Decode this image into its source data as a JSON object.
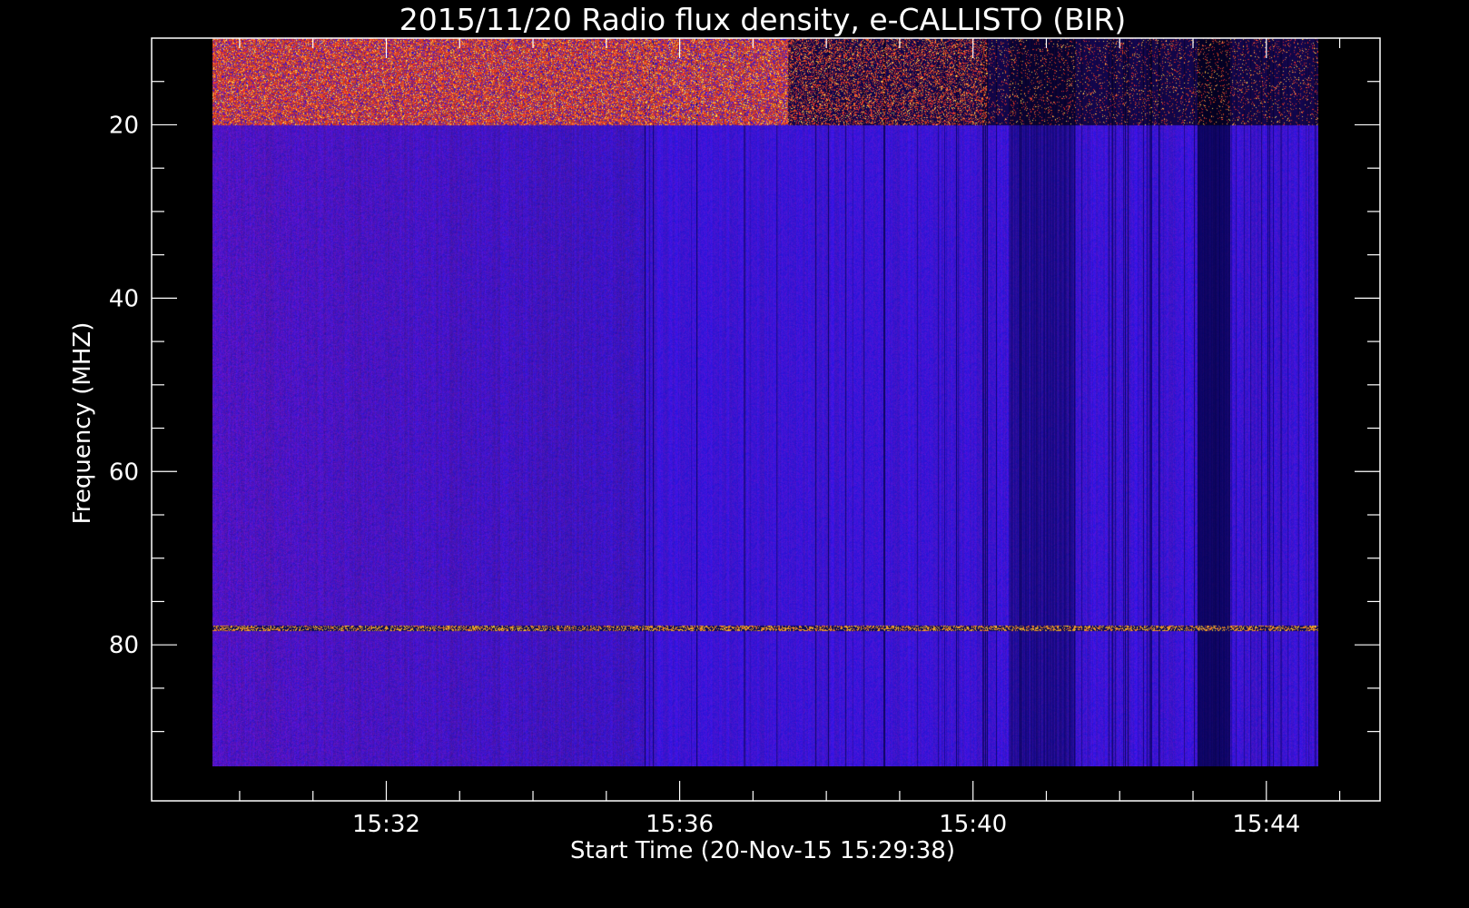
{
  "chart_data": {
    "type": "heatmap",
    "title": "2015/11/20  Radio flux density, e-CALLISTO (BIR)",
    "xlabel": "Start Time (20-Nov-15 15:29:38)",
    "ylabel": "Frequency (MHZ)",
    "x_axis": {
      "unit": "minutes after 15:29:38",
      "range": [
        -0.83,
        15.92
      ],
      "data_range": [
        0.0,
        15.08
      ],
      "major_ticks": [
        {
          "label": "15:32",
          "value": 2.37
        },
        {
          "label": "15:36",
          "value": 6.37
        },
        {
          "label": "15:40",
          "value": 10.37
        },
        {
          "label": "15:44",
          "value": 14.37
        }
      ],
      "minor_tick_step": 1
    },
    "y_axis": {
      "unit": "MHz",
      "inverted": true,
      "range": [
        10,
        98
      ],
      "data_range": [
        10,
        94
      ],
      "major_ticks": [
        20,
        40,
        60,
        80
      ],
      "minor_ticks": [
        15,
        25,
        30,
        35,
        45,
        50,
        55,
        65,
        70,
        75,
        85,
        90
      ]
    },
    "colormap": [
      "#000000",
      "#1a10c8",
      "#2a12ff",
      "#8a1fa0",
      "#e02010",
      "#ff8020",
      "#ffffc0"
    ],
    "features": [
      {
        "name": "strong emission band",
        "freq_range_mhz": [
          10,
          20
        ],
        "time_range_min": [
          0.0,
          7.5
        ]
      },
      {
        "name": "persistent narrow line",
        "freq_mhz": 78,
        "time_range_min": [
          0.0,
          15.08
        ]
      },
      {
        "name": "broadband dark stripes",
        "time_range_min": [
          7.5,
          15.08
        ]
      }
    ],
    "grid": false,
    "legend": "none"
  },
  "colors": {
    "background": "#000000",
    "axes": "#ffffff",
    "text": "#ffffff"
  }
}
